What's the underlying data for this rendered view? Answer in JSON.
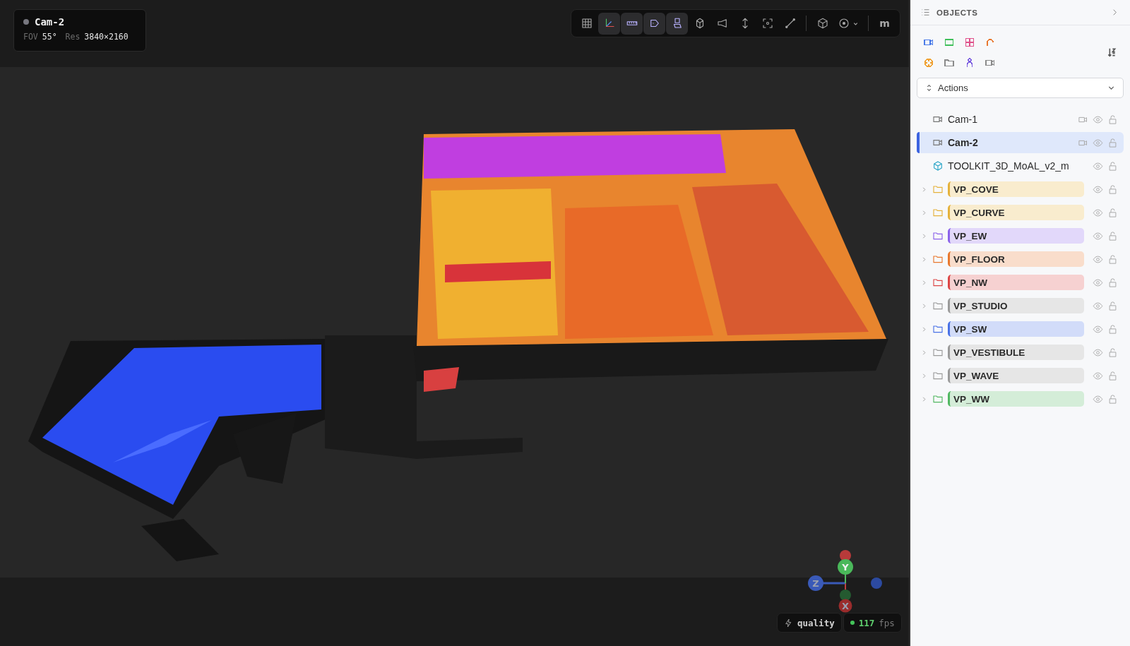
{
  "camera_card": {
    "name": "Cam-2",
    "fov_label": "FOV",
    "fov": "55°",
    "res_label": "Res",
    "res": "3840×2160"
  },
  "toolbar": {
    "groups": [
      [
        {
          "kind": "grid",
          "selected": false
        },
        {
          "kind": "axes",
          "selected": true
        },
        {
          "kind": "ruler",
          "selected": true
        },
        {
          "kind": "tag",
          "selected": true
        },
        {
          "kind": "layers",
          "selected": true
        },
        {
          "kind": "gem",
          "selected": false
        },
        {
          "kind": "projector",
          "selected": false
        },
        {
          "kind": "updown",
          "selected": false
        },
        {
          "kind": "focus",
          "selected": false
        },
        {
          "kind": "line",
          "selected": false
        }
      ],
      [
        {
          "kind": "box",
          "selected": false
        },
        {
          "kind": "target",
          "selected": false,
          "dropdown": true
        }
      ],
      [
        {
          "kind": "text",
          "label": "m",
          "selected": false
        }
      ]
    ]
  },
  "gizmo": {
    "axes": [
      {
        "label": "Y"
      },
      {
        "label": "Z"
      },
      {
        "label": "X"
      }
    ]
  },
  "stats": {
    "mode": "quality",
    "fps": "117",
    "fps_unit": "fps"
  },
  "panel": {
    "title": "OBJECTS",
    "filters": [
      {
        "kind": "camera",
        "color": "#4a7be8"
      },
      {
        "kind": "rect",
        "color": "#3fbf5a"
      },
      {
        "kind": "grid4",
        "color": "#e0508a"
      },
      {
        "kind": "arc",
        "color": "#e8772e"
      },
      {
        "kind": "sun",
        "color": "#f0a030"
      },
      {
        "kind": "folder",
        "color": "#8a8a8a"
      },
      {
        "kind": "person",
        "color": "#7a5ce0"
      },
      {
        "kind": "camera",
        "color": "#8a8a8a"
      }
    ],
    "actions": {
      "label": "Actions"
    },
    "items": [
      {
        "kind": "camera",
        "label": "Cam-1",
        "selected": false
      },
      {
        "kind": "camera",
        "label": "Cam-2",
        "selected": true
      },
      {
        "kind": "model",
        "label": "TOOLKIT_3D_MoAL_v2_m",
        "selected": false
      },
      {
        "kind": "folder",
        "label": "VP_COVE",
        "color": "#e5b23c",
        "expanded": false,
        "selected": false
      },
      {
        "kind": "folder",
        "label": "VP_CURVE",
        "color": "#e5b23c",
        "expanded": false,
        "selected": false
      },
      {
        "kind": "folder",
        "label": "VP_EW",
        "color": "#8b62ea",
        "expanded": false,
        "selected": false
      },
      {
        "kind": "folder",
        "label": "VP_FLOOR",
        "color": "#e8782e",
        "expanded": false,
        "selected": false
      },
      {
        "kind": "folder",
        "label": "VP_NW",
        "color": "#dc4646",
        "expanded": false,
        "selected": false
      },
      {
        "kind": "folder",
        "label": "VP_STUDIO",
        "color": "#9a9a9a",
        "expanded": false,
        "selected": false
      },
      {
        "kind": "folder",
        "label": "VP_SW",
        "color": "#4a72e6",
        "expanded": false,
        "selected": false
      },
      {
        "kind": "folder",
        "label": "VP_VESTIBULE",
        "color": "#9a9a9a",
        "expanded": false,
        "selected": false
      },
      {
        "kind": "folder",
        "label": "VP_WAVE",
        "color": "#9a9a9a",
        "expanded": false,
        "selected": false
      },
      {
        "kind": "folder",
        "label": "VP_WW",
        "color": "#52b862",
        "expanded": false,
        "selected": false
      }
    ]
  }
}
